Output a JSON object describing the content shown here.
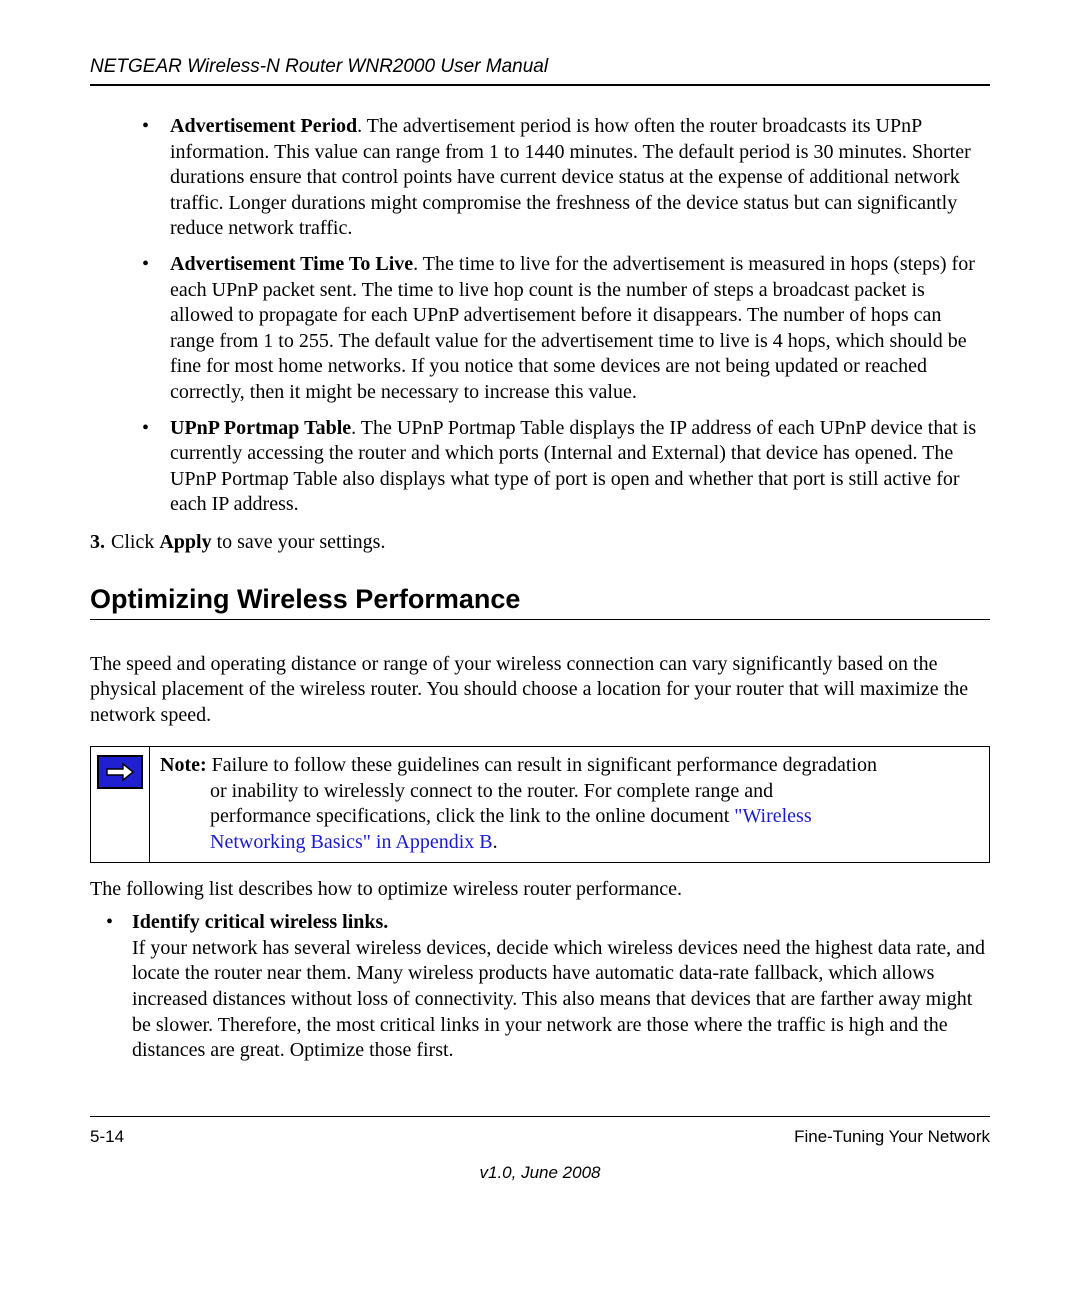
{
  "header": {
    "running_title": "NETGEAR Wireless-N Router WNR2000 User Manual"
  },
  "bullets": [
    {
      "term": "Advertisement Period",
      "desc": ". The advertisement period is how often the router broadcasts its UPnP information. This value can range from 1 to 1440 minutes. The default period is 30 minutes. Shorter durations ensure that control points have current device status at the expense of additional network traffic. Longer durations might compromise the freshness of the device status but can significantly reduce network traffic."
    },
    {
      "term": "Advertisement Time To Live",
      "desc": ". The time to live for the advertisement is measured in hops (steps) for each UPnP packet sent. The time to live hop count is the number of steps a broadcast packet is allowed to propagate for each UPnP advertisement before it disappears. The number of hops can range from 1 to 255. The default value for the advertisement time to live is 4 hops, which should be fine for most home networks. If you notice that some devices are not being updated or reached correctly, then it might be necessary to increase this value."
    },
    {
      "term": "UPnP Portmap Table",
      "desc": ". The UPnP Portmap Table displays the IP address of each UPnP device that is currently accessing the router and which ports (Internal and External) that device has opened. The UPnP Portmap Table also displays what type of port is open and whether that port is still active for each IP address."
    }
  ],
  "step": {
    "number": "3.",
    "pre": "Click ",
    "bold": "Apply",
    "post": " to save your settings."
  },
  "section_heading": "Optimizing Wireless Performance",
  "intro_para": "The speed and operating distance or range of your wireless connection can vary significantly based on the physical placement of the wireless router. You should choose a location for your router that will maximize the network speed.",
  "note": {
    "label": "Note:",
    "line1": " Failure to follow these guidelines can result in significant performance degradation",
    "line2a": "or inability to wirelessly connect to the router. For complete range and",
    "line2b": "performance specifications, click the link to the online document ",
    "link1": "\"Wireless",
    "link2": "Networking Basics\" in Appendix B",
    "period": "."
  },
  "followup_para": "The following list describes how to optimize wireless router performance.",
  "opt_bullet": {
    "title": "Identify critical wireless links.",
    "body": "If your network has several wireless devices, decide which wireless devices need the highest data rate, and locate the router near them. Many wireless products have automatic data-rate fallback, which allows increased distances without loss of connectivity. This also means that devices that are farther away might be slower. Therefore, the most critical links in your network are those where the traffic is high and the distances are great. Optimize those first."
  },
  "footer": {
    "page": "5-14",
    "chapter": "Fine-Tuning Your Network",
    "version": "v1.0, June 2008"
  }
}
